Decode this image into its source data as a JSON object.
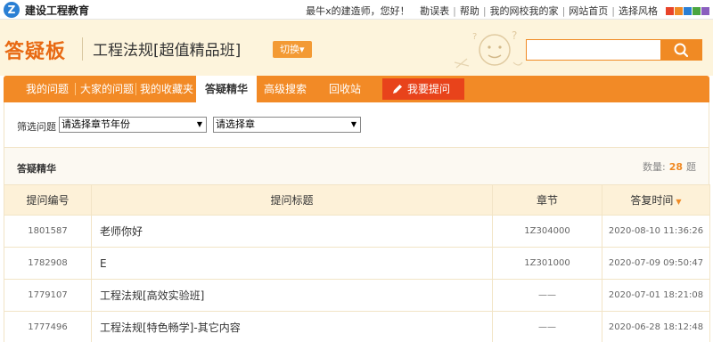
{
  "site": {
    "logo": "Z",
    "name": "建设工程教育"
  },
  "top_links": {
    "greeting": "最牛x的建造师，您好！",
    "links": [
      "勘误表",
      "帮助",
      "我的网校我的家",
      "网站首页",
      "选择风格"
    ]
  },
  "theme_colors": [
    "#e8442a",
    "#f08a24",
    "#2a7fd4",
    "#4aa540",
    "#8a5fbf"
  ],
  "header": {
    "brand": "答疑板",
    "course": "工程法规[超值精品班]",
    "switch_label": "切换▾"
  },
  "nav": {
    "items": [
      "我的问题",
      "大家的问题",
      "我的收藏夹",
      "答疑精华",
      "高级搜索",
      "回收站"
    ],
    "active": "答疑精华",
    "ask_label": "我要提问"
  },
  "filter": {
    "label": "筛选问题",
    "year_select": "请选择章节年份",
    "chapter_select": "请选择章"
  },
  "list": {
    "title": "答疑精华",
    "count_label": "数量:",
    "count_value": "28",
    "count_unit": "题",
    "columns": [
      "提问编号",
      "提问标题",
      "章节",
      "答复时间"
    ],
    "rows": [
      {
        "id": "1801587",
        "title": "老师你好",
        "chapter": "1Z304000",
        "time": "2020-08-10 11:36:26"
      },
      {
        "id": "1782908",
        "title": "E",
        "chapter": "1Z301000",
        "time": "2020-07-09 09:50:47"
      },
      {
        "id": "1779107",
        "title": "工程法规[高效实验班]",
        "chapter": "——",
        "time": "2020-07-01 18:21:08"
      },
      {
        "id": "1777496",
        "title": "工程法规[特色畅学]-其它内容",
        "chapter": "——",
        "time": "2020-06-28 18:12:48"
      }
    ]
  }
}
